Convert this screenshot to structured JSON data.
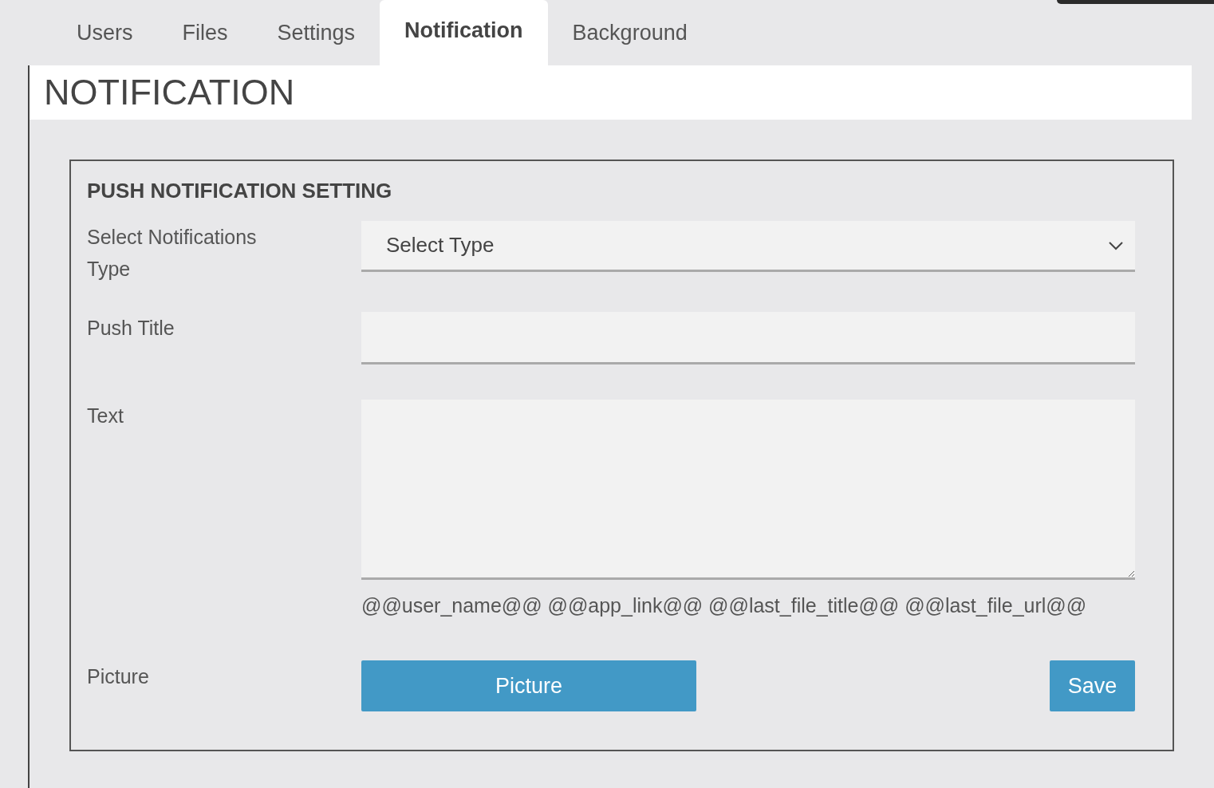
{
  "tabs": [
    {
      "label": "Users",
      "selected": false
    },
    {
      "label": "Files",
      "selected": false
    },
    {
      "label": "Settings",
      "selected": false
    },
    {
      "label": "Notification",
      "selected": true
    },
    {
      "label": "Background",
      "selected": false
    }
  ],
  "page_title": "NOTIFICATION",
  "section": {
    "title": "PUSH NOTIFICATION SETTING",
    "notification_type": {
      "label": "Select Notifications Type",
      "value": "Select Type"
    },
    "push_title": {
      "label": "Push Title"
    },
    "text": {
      "label": "Text",
      "hint": "@@user_name@@ @@app_link@@ @@last_file_title@@ @@last_file_url@@"
    },
    "picture": {
      "label": "Picture",
      "button": "Picture"
    },
    "save_button": "Save"
  }
}
